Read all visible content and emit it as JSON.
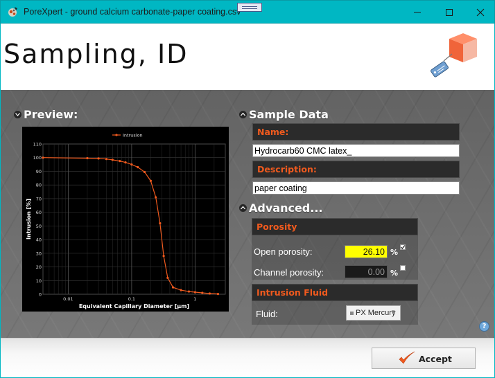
{
  "window": {
    "title": "PoreXpert - ground calcium carbonate-paper coating.csv",
    "accent": "#00b7c3"
  },
  "header": {
    "title": "Sampling, ID",
    "logo_icon": "cube-tag-logo-icon"
  },
  "preview": {
    "heading": "Preview:",
    "chart_data": {
      "type": "line",
      "title": "",
      "xlabel": "Equivalent Capillary Diameter [µm]",
      "ylabel": "Intrusion [%]",
      "x_scale": "log",
      "xlim": [
        0.004,
        3.0
      ],
      "ylim": [
        0,
        110
      ],
      "x_ticks": [
        "0.01",
        "0.1",
        "1"
      ],
      "y_ticks": [
        "0",
        "10",
        "20",
        "30",
        "40",
        "50",
        "60",
        "70",
        "80",
        "90",
        "100",
        "110"
      ],
      "grid": true,
      "legend": "top-center",
      "series": [
        {
          "name": "Intrusion",
          "color": "#f05a1e",
          "points": [
            [
              0.004,
              100
            ],
            [
              0.02,
              99.6
            ],
            [
              0.03,
              99.4
            ],
            [
              0.04,
              99
            ],
            [
              0.05,
              98.4
            ],
            [
              0.065,
              97.5
            ],
            [
              0.08,
              96.5
            ],
            [
              0.1,
              95
            ],
            [
              0.125,
              93
            ],
            [
              0.16,
              89.5
            ],
            [
              0.2,
              83
            ],
            [
              0.24,
              71
            ],
            [
              0.28,
              52
            ],
            [
              0.32,
              28
            ],
            [
              0.37,
              12
            ],
            [
              0.45,
              5
            ],
            [
              0.6,
              3
            ],
            [
              0.8,
              2
            ],
            [
              1.0,
              1.5
            ],
            [
              1.3,
              1
            ],
            [
              1.7,
              0.5
            ],
            [
              2.3,
              0.2
            ]
          ]
        }
      ]
    }
  },
  "sample_data": {
    "heading": "Sample Data",
    "name_label": "Name:",
    "name_value": "Hydrocarb60 CMC latex_",
    "description_label": "Description:",
    "description_value": "paper coating"
  },
  "advanced": {
    "heading": "Advanced...",
    "porosity": {
      "heading": "Porosity",
      "open_label": "Open porosity:",
      "open_value": "26.10",
      "open_unit": "%",
      "open_checked": true,
      "channel_label": "Channel porosity:",
      "channel_value": "0.00",
      "channel_unit": "%",
      "channel_checked": false
    },
    "intrusion_fluid": {
      "heading": "Intrusion Fluid",
      "fluid_label": "Fluid:",
      "fluid_value": "PX Mercury"
    }
  },
  "footer": {
    "accept_label": "Accept"
  }
}
